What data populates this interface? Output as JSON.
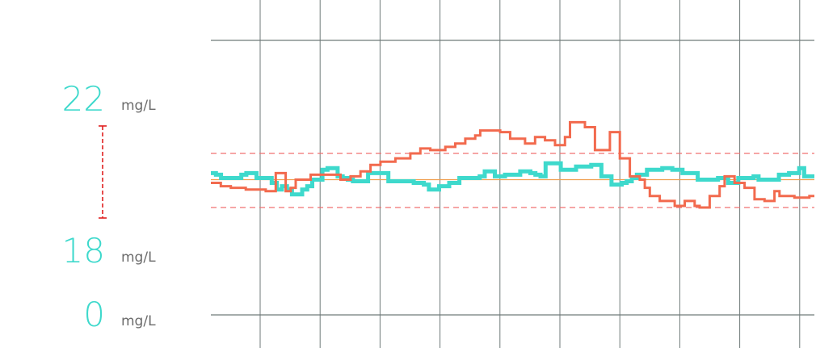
{
  "readout": {
    "high": {
      "value": "22",
      "unit": "mg/L"
    },
    "mid": {
      "value": "18",
      "unit": "mg/L"
    },
    "low": {
      "value": "0",
      "unit": "mg/L"
    }
  },
  "colors": {
    "teal": "#3ed9cc",
    "coral": "#f26a4e",
    "grid": "#6f7a79",
    "limit": "#f07070",
    "target": "#f0a050",
    "bracket": "#e02020"
  },
  "chart_data": {
    "type": "line",
    "step": true,
    "title": "",
    "xlabel": "",
    "ylabel": "",
    "grid": true,
    "ylim": [
      0,
      30
    ],
    "target": 19.2,
    "limits": [
      17.5,
      20.8
    ],
    "vertical_grid_count": 10,
    "series": [
      {
        "color": "#3ed9cc",
        "values": [
          19.6,
          19.5,
          19.3,
          19.3,
          19.3,
          19.3,
          19.5,
          19.6,
          19.6,
          19.3,
          19.3,
          19.3,
          19.0,
          18.6,
          18.8,
          18.6,
          18.3,
          18.3,
          18.6,
          18.8,
          19.2,
          19.2,
          19.8,
          19.9,
          19.9,
          19.4,
          19.3,
          19.2,
          19.1,
          19.1,
          19.1,
          19.6,
          19.6,
          19.6,
          19.6,
          19.1,
          19.1,
          19.1,
          19.1,
          19.1,
          19.0,
          19.0,
          18.9,
          18.6,
          18.6,
          18.8,
          18.8,
          19.0,
          19.0,
          19.3,
          19.3,
          19.3,
          19.3,
          19.4,
          19.7,
          19.7,
          19.4,
          19.4,
          19.5,
          19.5,
          19.5,
          19.7,
          19.7,
          19.6,
          19.5,
          19.4,
          20.2,
          20.2,
          20.2,
          19.8,
          19.8,
          19.8,
          20.0,
          20.0,
          20.0,
          20.1,
          20.1,
          19.4,
          19.4,
          18.9,
          18.9,
          19.0,
          19.1,
          19.3,
          19.5,
          19.5,
          19.8,
          19.8,
          19.8,
          19.9,
          19.9,
          19.8,
          19.8,
          19.6,
          19.6,
          19.6,
          19.2,
          19.2,
          19.2,
          19.2,
          19.3,
          19.3,
          19.0,
          19.0,
          19.3,
          19.3,
          19.3,
          19.4,
          19.2,
          19.2,
          19.2,
          19.2,
          19.5,
          19.5,
          19.6,
          19.6,
          19.9,
          19.4,
          19.4
        ]
      },
      {
        "color": "#f26a4e",
        "values": [
          19.0,
          19.0,
          18.8,
          18.8,
          18.7,
          18.7,
          18.7,
          18.6,
          18.6,
          18.6,
          18.6,
          18.5,
          18.5,
          19.6,
          19.6,
          18.5,
          18.7,
          19.2,
          19.2,
          19.2,
          19.5,
          19.5,
          19.5,
          19.5,
          19.5,
          19.5,
          19.2,
          19.2,
          19.4,
          19.4,
          19.7,
          19.7,
          20.1,
          20.1,
          20.3,
          20.3,
          20.3,
          20.5,
          20.5,
          20.5,
          20.8,
          20.8,
          21.1,
          21.1,
          21.0,
          21.0,
          21.0,
          21.2,
          21.2,
          21.4,
          21.4,
          21.7,
          21.7,
          21.9,
          22.2,
          22.2,
          22.2,
          22.2,
          22.1,
          22.1,
          21.7,
          21.7,
          21.7,
          21.4,
          21.4,
          21.8,
          21.8,
          21.6,
          21.6,
          21.3,
          21.3,
          21.8,
          22.7,
          22.7,
          22.7,
          22.4,
          22.4,
          21.0,
          21.0,
          21.0,
          22.1,
          22.1,
          20.5,
          20.5,
          19.4,
          19.4,
          19.2,
          18.7,
          18.2,
          18.2,
          17.9,
          17.9,
          17.9,
          17.6,
          17.6,
          17.9,
          17.9,
          17.6,
          17.5,
          17.5,
          18.2,
          18.2,
          18.8,
          19.4,
          19.4,
          19.0,
          19.0,
          18.7,
          18.7,
          18.0,
          18.0,
          17.9,
          17.9,
          18.5,
          18.2,
          18.2,
          18.2,
          18.1,
          18.1,
          18.1,
          18.2
        ]
      }
    ]
  }
}
